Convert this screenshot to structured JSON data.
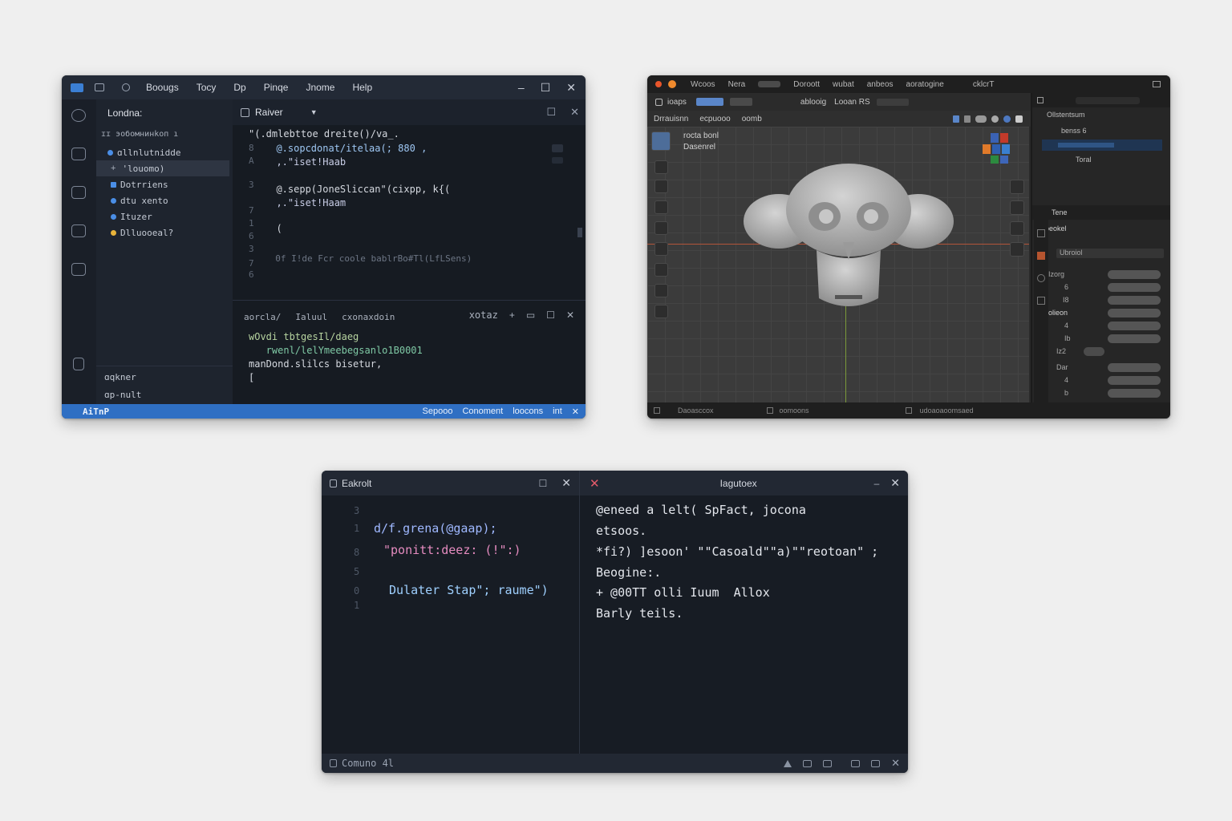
{
  "editor_window": {
    "menu": [
      "Boougs",
      "Tocy",
      "Dp",
      "Pinqe",
      "Jnome",
      "Help"
    ],
    "sidebar": {
      "title": "Londna:",
      "section": "ɪɪ эoбомнинkоп ı",
      "items": [
        {
          "label": "ɑllnlutnidde",
          "color": "#4a8ee6"
        },
        {
          "label": "'louomo)",
          "color": ""
        },
        {
          "label": "Dotrriens",
          "color": "#4a8ee6"
        },
        {
          "label": "dtu xento",
          "color": "#4a8ee6"
        },
        {
          "label": "Ituzer",
          "color": "#4a8ee6"
        },
        {
          "label": "Dlluooeal?",
          "color": "#e8b33a"
        }
      ],
      "footer": [
        "ɑqkner",
        "ɑp-nult"
      ]
    },
    "tab": {
      "label": "Raiver"
    },
    "gutter": [
      "8",
      "A",
      "3",
      "7",
      "1",
      "6",
      "3",
      "7",
      "6"
    ],
    "code": [
      {
        "text": "\"(.dmlebttoe dreite()/va_.",
        "color": "#d5d9e0"
      },
      {
        "text": "  @.sopcdonat/itelaa(; 880 ,",
        "color": "#9ec7f3"
      },
      {
        "text": "  ,.\"iset!Haab",
        "color": "#c8cde6"
      },
      {
        "text": "  @.sepp(JoneSliccan\"(cixpp, k{(",
        "color": "#d5d9e0"
      },
      {
        "text": "  ,.\"iset!Haam",
        "color": "#c8cde6"
      },
      {
        "text": "  (",
        "color": "#d5d9e0"
      },
      {
        "text": "  0f I!de Fcr coole bablrBo#Tl(LfLSens)",
        "color": "#6c7584"
      }
    ],
    "terminal": {
      "tabs": [
        "aorcla/",
        "Ialuul",
        "cxonaxdoin"
      ],
      "right_label": "xotaz",
      "lines": [
        {
          "text": "wOvdi tbtgesIl/daeg",
          "color": "#b7d4a0"
        },
        {
          "text": "   rwenl/lelYmeebegsanlo1B0001",
          "color": "#7fc9a5"
        },
        {
          "text": "manDond.slilcs bisetur,",
          "color": "#d5d9e0"
        },
        {
          "text": "[",
          "color": "#d5d9e0"
        }
      ]
    },
    "status": {
      "left": "AiTnP",
      "right": [
        "Sepooo",
        "Conoment",
        "loocons",
        "int"
      ]
    }
  },
  "modeler_window": {
    "topbar": [
      "Wcoos",
      "Nera",
      "Doroott",
      "wubat",
      "anbeos",
      "aoratogine",
      "cklcrT"
    ],
    "toolbar": [
      "ioaps",
      "ablooig",
      "Looan RS"
    ],
    "header": [
      "Drrauisnn",
      "ecpuooo",
      "oomb"
    ],
    "viewport_text": [
      "rocta bonl",
      "Dasenrel"
    ],
    "outliner": [
      "Ollstentsum",
      "benss 6",
      "Toral"
    ],
    "props_title": "Tene",
    "props_sub": "Boeokel",
    "props_group": "Ubroiol",
    "props_label": "doolieon",
    "props_rows": [
      "Izorg",
      "6",
      "I8",
      "4",
      "Ib",
      "4",
      "Iz2",
      "Dar",
      "4",
      "b"
    ],
    "bottom": [
      "Daoasccox",
      "oomoons",
      "udoaoaoomsaed"
    ]
  },
  "split_window": {
    "left": {
      "title": "Eakrolt",
      "gutter": [
        "3",
        "1",
        "8",
        "5",
        "0",
        "1"
      ],
      "lines": [
        {
          "text": "d/f.grena(@gaap);",
          "color": "#9fb8ff",
          "accent": "#e9b36b"
        },
        {
          "text": "\"ponitt:deez: (!\":)",
          "color": "#e58bbf",
          "accent": "#e9c56b"
        },
        {
          "text": "Dulater Stap\"; raume\")",
          "color": "#9fd0ff",
          "accent": "#ec8a4a"
        }
      ]
    },
    "right": {
      "title": "Iagutoex",
      "lines": [
        "@eneed a lelt( SpFact, jocona",
        "etsoos.",
        "*fi?) ]esoon' \"\"Casoald\"\"a)\"\"reotoan\" ;",
        "Beogine:.",
        "+ @00TT olli Iuum  Allox",
        "Barly teils."
      ]
    },
    "status": "Comuno 4l"
  }
}
